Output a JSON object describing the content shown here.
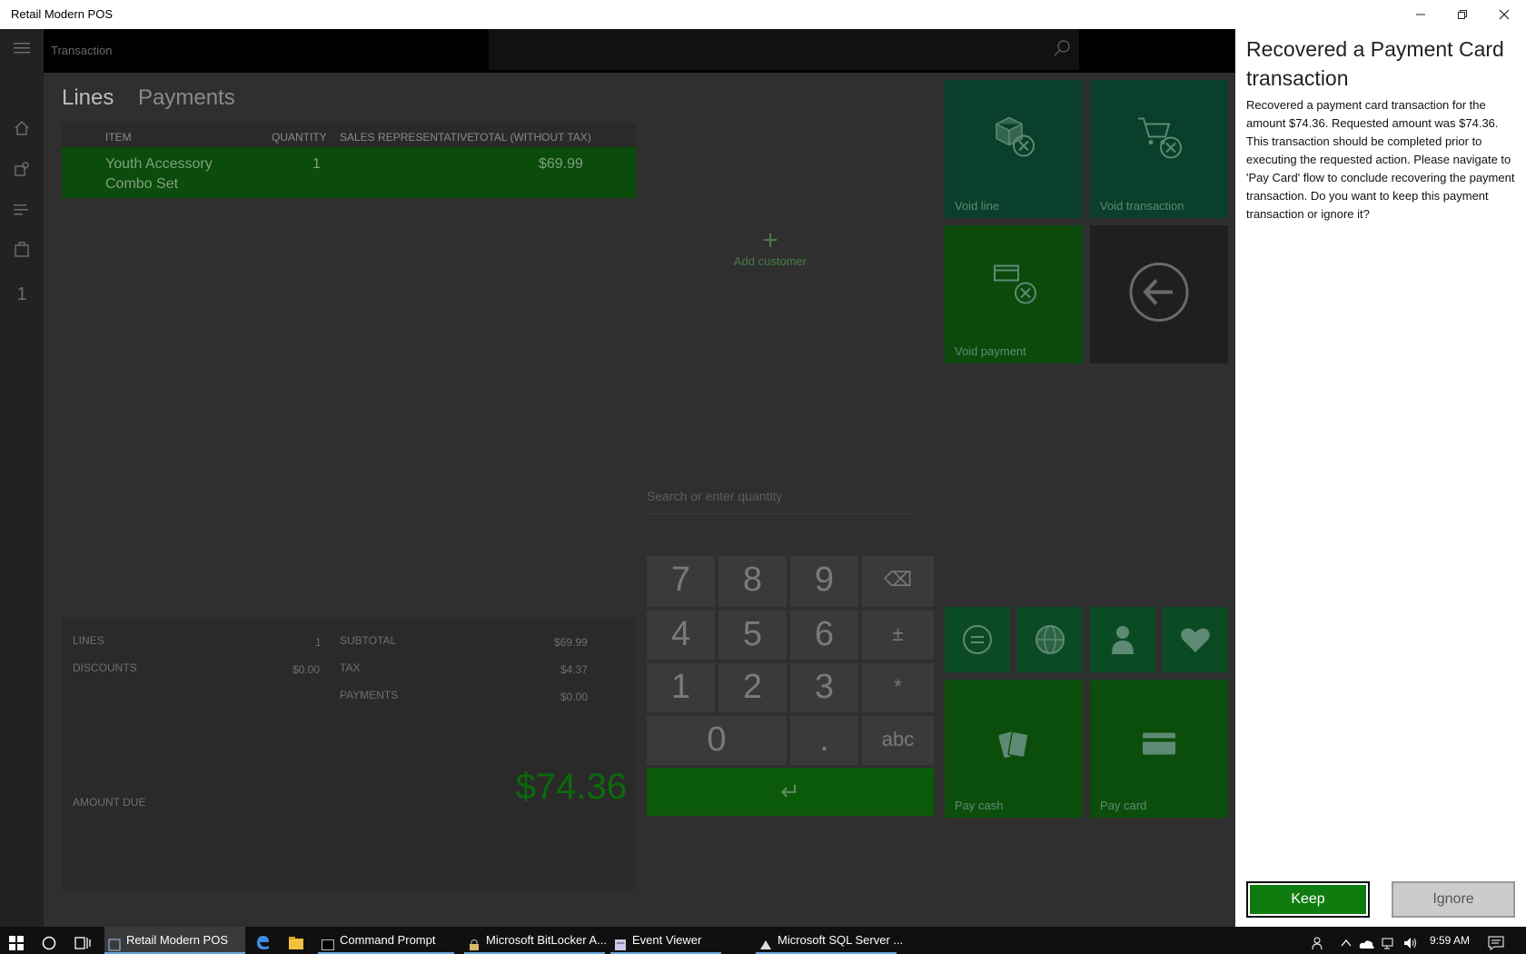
{
  "window": {
    "title": "Retail Modern POS"
  },
  "topbar": {
    "title": "Transaction"
  },
  "tabs": [
    {
      "label": "Lines",
      "active": true
    },
    {
      "label": "Payments",
      "active": false
    }
  ],
  "grid": {
    "headers": [
      "ITEM",
      "QUANTITY",
      "SALES REPRESENTATIVE",
      "TOTAL (WITHOUT TAX)"
    ],
    "rows": [
      {
        "item_line1": "Youth Accessory",
        "item_line2": "Combo Set",
        "quantity": "1",
        "rep": "",
        "total": "$69.99"
      }
    ]
  },
  "totals": {
    "lines_label": "LINES",
    "lines_value": "1",
    "discounts_label": "DISCOUNTS",
    "discounts_value": "$0.00",
    "subtotal_label": "SUBTOTAL",
    "subtotal_value": "$69.99",
    "tax_label": "TAX",
    "tax_value": "$4.37",
    "payments_label": "PAYMENTS",
    "payments_value": "$0.00",
    "amount_due_label": "AMOUNT DUE",
    "amount_due_value": "$74.36"
  },
  "add_customer": {
    "label": "Add customer"
  },
  "search": {
    "placeholder": "Search or enter quantity"
  },
  "numpad": {
    "keys": [
      "7",
      "8",
      "9",
      "⌫",
      "4",
      "5",
      "6",
      "±",
      "1",
      "2",
      "3",
      "*",
      "0",
      ".",
      "abc"
    ],
    "enter": "↵"
  },
  "tiles": {
    "void_line": "Void line",
    "void_transaction": "Void transaction",
    "void_payment": "Void payment",
    "pay_cash": "Pay cash",
    "pay_card": "Pay card"
  },
  "dialog": {
    "title": "Recovered a Payment Card transaction",
    "message": "Recovered a payment card transaction for the amount $74.36. Requested amount was $74.36. This transaction should be completed prior to executing the requested action. Please navigate to 'Pay Card' flow to conclude recovering the payment transaction. Do you want to keep this payment transaction or ignore it?",
    "keep_label": "Keep",
    "ignore_label": "Ignore"
  },
  "taskbar": {
    "items": [
      {
        "label": "Retail Modern POS",
        "active": true
      },
      {
        "label": "Command Prompt",
        "active": false
      },
      {
        "label": "Microsoft BitLocker A...",
        "active": false
      },
      {
        "label": "Event Viewer",
        "active": false
      },
      {
        "label": "Microsoft SQL Server ...",
        "active": false
      }
    ],
    "clock": "9:59 AM"
  },
  "colors": {
    "accent_green": "#107c10",
    "tile_teal": "#0a3f2b"
  }
}
